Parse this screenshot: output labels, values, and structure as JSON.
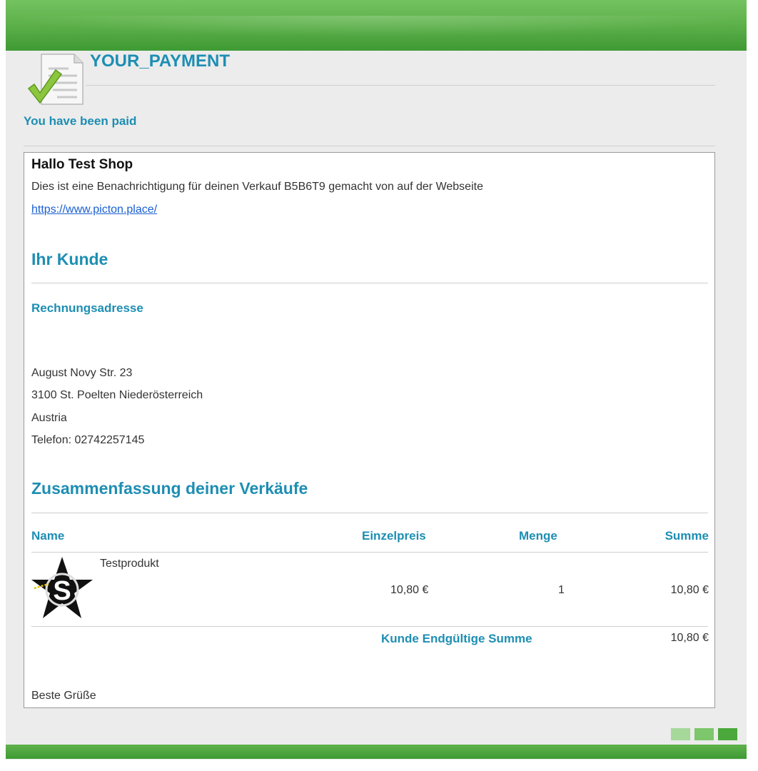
{
  "header": {
    "title": "YOUR_PAYMENT",
    "subtitle": "You have been paid"
  },
  "email": {
    "greeting": "Hallo Test Shop",
    "intro": "Dies ist eine Benachrichtigung für deinen Verkauf B5B6T9 gemacht von auf der Webseite",
    "link": "https://www.picton.place/",
    "customer_heading": "Ihr Kunde",
    "billing_heading": "Rechnungsadresse",
    "address": [
      "August Novy Str. 23",
      "3100 St. Poelten Niederösterreich",
      "Austria",
      "Telefon: 02742257145"
    ],
    "summary_heading": "Zusammenfassung deiner Verkäufe",
    "columns": {
      "name": "Name",
      "unit_price": "Einzelpreis",
      "quantity": "Menge",
      "total": "Summe"
    },
    "items": [
      {
        "name": "Testprodukt",
        "unit_price": "10,80 €",
        "quantity": "1",
        "total": "10,80 €",
        "image_icon": "star-logo-icon"
      }
    ],
    "grand_total_label": "Kunde Endgültige Summe",
    "grand_total": "10,80 €",
    "signoff": "Beste Grüße"
  },
  "colors": {
    "accent": "#1d8eb3",
    "header_green": "#5fb24c",
    "link": "#1a5fd0",
    "squares": [
      "#a6d899",
      "#7cc66b",
      "#4aa93a"
    ]
  }
}
